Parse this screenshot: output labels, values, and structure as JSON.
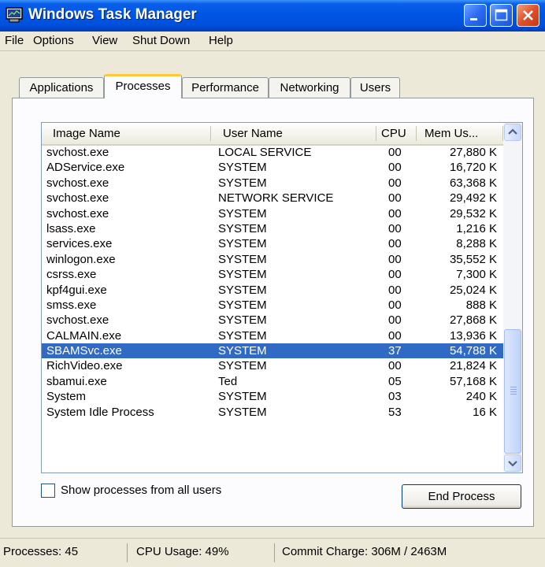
{
  "window": {
    "title": "Windows Task Manager"
  },
  "menu": [
    "File",
    "Options",
    "View",
    "Shut Down",
    "Help"
  ],
  "tabs": [
    "Applications",
    "Processes",
    "Performance",
    "Networking",
    "Users"
  ],
  "active_tab": "Processes",
  "columns": {
    "image_name": "Image Name",
    "user_name": "User Name",
    "cpu": "CPU",
    "mem": "Mem Us..."
  },
  "processes": [
    {
      "name": "svchost.exe",
      "user": "LOCAL SERVICE",
      "cpu": "00",
      "mem": "27,880 K"
    },
    {
      "name": "ADService.exe",
      "user": "SYSTEM",
      "cpu": "00",
      "mem": "16,720 K"
    },
    {
      "name": "svchost.exe",
      "user": "SYSTEM",
      "cpu": "00",
      "mem": "63,368 K"
    },
    {
      "name": "svchost.exe",
      "user": "NETWORK SERVICE",
      "cpu": "00",
      "mem": "29,492 K"
    },
    {
      "name": "svchost.exe",
      "user": "SYSTEM",
      "cpu": "00",
      "mem": "29,532 K"
    },
    {
      "name": "lsass.exe",
      "user": "SYSTEM",
      "cpu": "00",
      "mem": "1,216 K"
    },
    {
      "name": "services.exe",
      "user": "SYSTEM",
      "cpu": "00",
      "mem": "8,288 K"
    },
    {
      "name": "winlogon.exe",
      "user": "SYSTEM",
      "cpu": "00",
      "mem": "35,552 K"
    },
    {
      "name": "csrss.exe",
      "user": "SYSTEM",
      "cpu": "00",
      "mem": "7,300 K"
    },
    {
      "name": "kpf4gui.exe",
      "user": "SYSTEM",
      "cpu": "00",
      "mem": "25,024 K"
    },
    {
      "name": "smss.exe",
      "user": "SYSTEM",
      "cpu": "00",
      "mem": "888 K"
    },
    {
      "name": "svchost.exe",
      "user": "SYSTEM",
      "cpu": "00",
      "mem": "27,868 K"
    },
    {
      "name": "CALMAIN.exe",
      "user": "SYSTEM",
      "cpu": "00",
      "mem": "13,936 K"
    },
    {
      "name": "SBAMSvc.exe",
      "user": "SYSTEM",
      "cpu": "37",
      "mem": "54,788 K"
    },
    {
      "name": "RichVideo.exe",
      "user": "SYSTEM",
      "cpu": "00",
      "mem": "21,824 K"
    },
    {
      "name": "sbamui.exe",
      "user": "Ted",
      "cpu": "05",
      "mem": "57,168 K"
    },
    {
      "name": "System",
      "user": "SYSTEM",
      "cpu": "03",
      "mem": "240 K"
    },
    {
      "name": "System Idle Process",
      "user": "SYSTEM",
      "cpu": "53",
      "mem": "16 K"
    }
  ],
  "selected_row": 13,
  "show_all_users": {
    "label": "Show processes from all users",
    "checked": false
  },
  "end_process_label": "End Process",
  "status": {
    "processes": "Processes: 45",
    "cpu_usage": "CPU Usage: 49%",
    "commit_charge": "Commit Charge: 306M / 2463M"
  },
  "colors": {
    "titlebar": "#0055E5",
    "selection": "#316AC5",
    "window_bg": "#ECE9D8",
    "close_button": "#E0502A"
  },
  "icons": [
    "taskmanager-app-icon",
    "minimize-icon",
    "maximize-icon",
    "close-icon",
    "scroll-up-arrow-icon",
    "scroll-down-arrow-icon",
    "scroll-grip-icon"
  ]
}
